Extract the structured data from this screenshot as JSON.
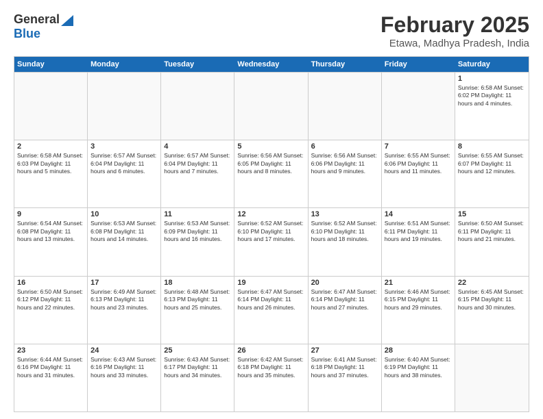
{
  "logo": {
    "general": "General",
    "blue": "Blue"
  },
  "title": {
    "month": "February 2025",
    "location": "Etawa, Madhya Pradesh, India"
  },
  "header_days": [
    "Sunday",
    "Monday",
    "Tuesday",
    "Wednesday",
    "Thursday",
    "Friday",
    "Saturday"
  ],
  "weeks": [
    [
      {
        "day": "",
        "info": ""
      },
      {
        "day": "",
        "info": ""
      },
      {
        "day": "",
        "info": ""
      },
      {
        "day": "",
        "info": ""
      },
      {
        "day": "",
        "info": ""
      },
      {
        "day": "",
        "info": ""
      },
      {
        "day": "1",
        "info": "Sunrise: 6:58 AM\nSunset: 6:02 PM\nDaylight: 11 hours\nand 4 minutes."
      }
    ],
    [
      {
        "day": "2",
        "info": "Sunrise: 6:58 AM\nSunset: 6:03 PM\nDaylight: 11 hours\nand 5 minutes."
      },
      {
        "day": "3",
        "info": "Sunrise: 6:57 AM\nSunset: 6:04 PM\nDaylight: 11 hours\nand 6 minutes."
      },
      {
        "day": "4",
        "info": "Sunrise: 6:57 AM\nSunset: 6:04 PM\nDaylight: 11 hours\nand 7 minutes."
      },
      {
        "day": "5",
        "info": "Sunrise: 6:56 AM\nSunset: 6:05 PM\nDaylight: 11 hours\nand 8 minutes."
      },
      {
        "day": "6",
        "info": "Sunrise: 6:56 AM\nSunset: 6:06 PM\nDaylight: 11 hours\nand 9 minutes."
      },
      {
        "day": "7",
        "info": "Sunrise: 6:55 AM\nSunset: 6:06 PM\nDaylight: 11 hours\nand 11 minutes."
      },
      {
        "day": "8",
        "info": "Sunrise: 6:55 AM\nSunset: 6:07 PM\nDaylight: 11 hours\nand 12 minutes."
      }
    ],
    [
      {
        "day": "9",
        "info": "Sunrise: 6:54 AM\nSunset: 6:08 PM\nDaylight: 11 hours\nand 13 minutes."
      },
      {
        "day": "10",
        "info": "Sunrise: 6:53 AM\nSunset: 6:08 PM\nDaylight: 11 hours\nand 14 minutes."
      },
      {
        "day": "11",
        "info": "Sunrise: 6:53 AM\nSunset: 6:09 PM\nDaylight: 11 hours\nand 16 minutes."
      },
      {
        "day": "12",
        "info": "Sunrise: 6:52 AM\nSunset: 6:10 PM\nDaylight: 11 hours\nand 17 minutes."
      },
      {
        "day": "13",
        "info": "Sunrise: 6:52 AM\nSunset: 6:10 PM\nDaylight: 11 hours\nand 18 minutes."
      },
      {
        "day": "14",
        "info": "Sunrise: 6:51 AM\nSunset: 6:11 PM\nDaylight: 11 hours\nand 19 minutes."
      },
      {
        "day": "15",
        "info": "Sunrise: 6:50 AM\nSunset: 6:11 PM\nDaylight: 11 hours\nand 21 minutes."
      }
    ],
    [
      {
        "day": "16",
        "info": "Sunrise: 6:50 AM\nSunset: 6:12 PM\nDaylight: 11 hours\nand 22 minutes."
      },
      {
        "day": "17",
        "info": "Sunrise: 6:49 AM\nSunset: 6:13 PM\nDaylight: 11 hours\nand 23 minutes."
      },
      {
        "day": "18",
        "info": "Sunrise: 6:48 AM\nSunset: 6:13 PM\nDaylight: 11 hours\nand 25 minutes."
      },
      {
        "day": "19",
        "info": "Sunrise: 6:47 AM\nSunset: 6:14 PM\nDaylight: 11 hours\nand 26 minutes."
      },
      {
        "day": "20",
        "info": "Sunrise: 6:47 AM\nSunset: 6:14 PM\nDaylight: 11 hours\nand 27 minutes."
      },
      {
        "day": "21",
        "info": "Sunrise: 6:46 AM\nSunset: 6:15 PM\nDaylight: 11 hours\nand 29 minutes."
      },
      {
        "day": "22",
        "info": "Sunrise: 6:45 AM\nSunset: 6:15 PM\nDaylight: 11 hours\nand 30 minutes."
      }
    ],
    [
      {
        "day": "23",
        "info": "Sunrise: 6:44 AM\nSunset: 6:16 PM\nDaylight: 11 hours\nand 31 minutes."
      },
      {
        "day": "24",
        "info": "Sunrise: 6:43 AM\nSunset: 6:16 PM\nDaylight: 11 hours\nand 33 minutes."
      },
      {
        "day": "25",
        "info": "Sunrise: 6:43 AM\nSunset: 6:17 PM\nDaylight: 11 hours\nand 34 minutes."
      },
      {
        "day": "26",
        "info": "Sunrise: 6:42 AM\nSunset: 6:18 PM\nDaylight: 11 hours\nand 35 minutes."
      },
      {
        "day": "27",
        "info": "Sunrise: 6:41 AM\nSunset: 6:18 PM\nDaylight: 11 hours\nand 37 minutes."
      },
      {
        "day": "28",
        "info": "Sunrise: 6:40 AM\nSunset: 6:19 PM\nDaylight: 11 hours\nand 38 minutes."
      },
      {
        "day": "",
        "info": ""
      }
    ]
  ]
}
